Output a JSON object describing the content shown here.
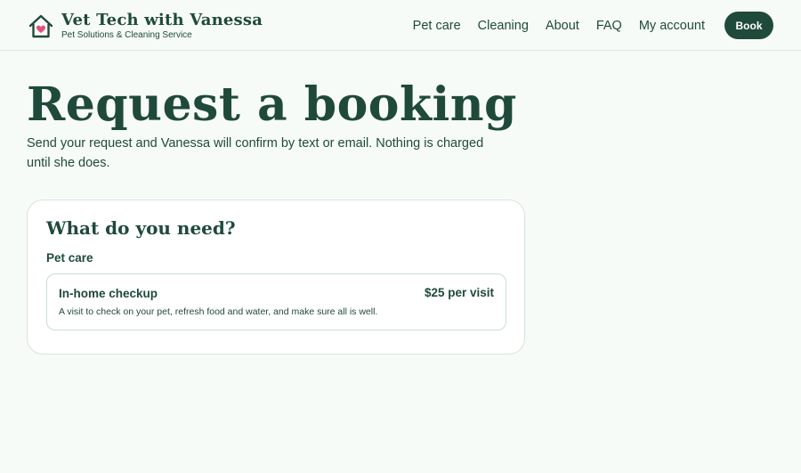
{
  "brand": {
    "title": "Vet Tech with Vanessa",
    "subtitle": "Pet Solutions & Cleaning Service",
    "icon": "house-heart-icon"
  },
  "nav": {
    "items": [
      "Pet care",
      "Cleaning",
      "About",
      "FAQ",
      "My account"
    ],
    "book_label": "Book"
  },
  "page": {
    "title": "Request a booking",
    "intro": "Send your request and Vanessa will confirm by text or email. Nothing is charged until she does."
  },
  "card": {
    "title": "What do you need?",
    "section": "Pet care",
    "service": {
      "name": "In-home checkup",
      "price": "$25 per visit",
      "description": "A visit to check on your pet, refresh food and water, and make sure all is well."
    }
  },
  "colors": {
    "primary": "#1f4a3b",
    "background": "#f7fbf8",
    "accent_heart": "#e0527a"
  }
}
